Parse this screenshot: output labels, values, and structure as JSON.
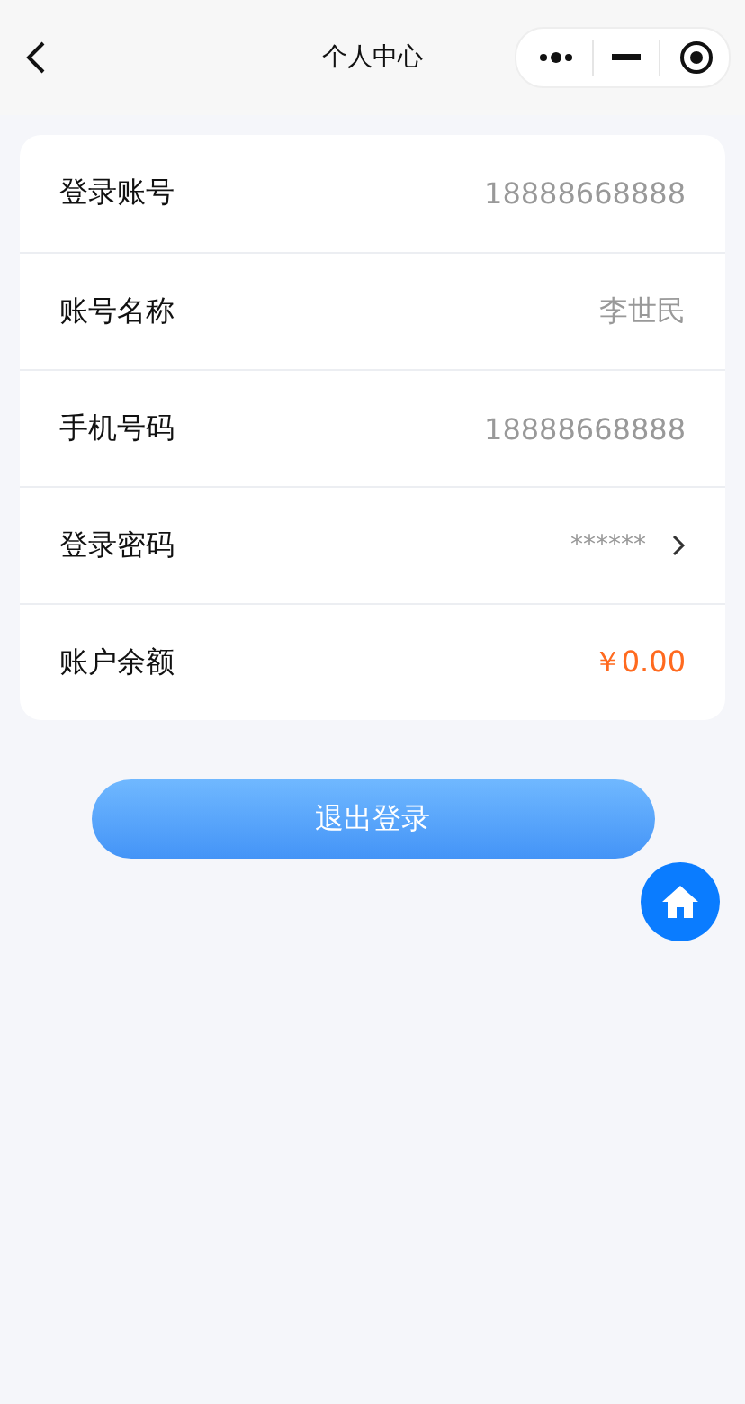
{
  "nav": {
    "title": "个人中心"
  },
  "rows": [
    {
      "label": "登录账号",
      "value": "18888668888",
      "kind": "plain"
    },
    {
      "label": "账号名称",
      "value": "李世民",
      "kind": "plain"
    },
    {
      "label": "手机号码",
      "value": "18888668888",
      "kind": "plain"
    },
    {
      "label": "登录密码",
      "value": "******",
      "kind": "link"
    },
    {
      "label": "账户余额",
      "value": "￥0.00",
      "kind": "amount"
    }
  ],
  "logout_button": "退出登录"
}
